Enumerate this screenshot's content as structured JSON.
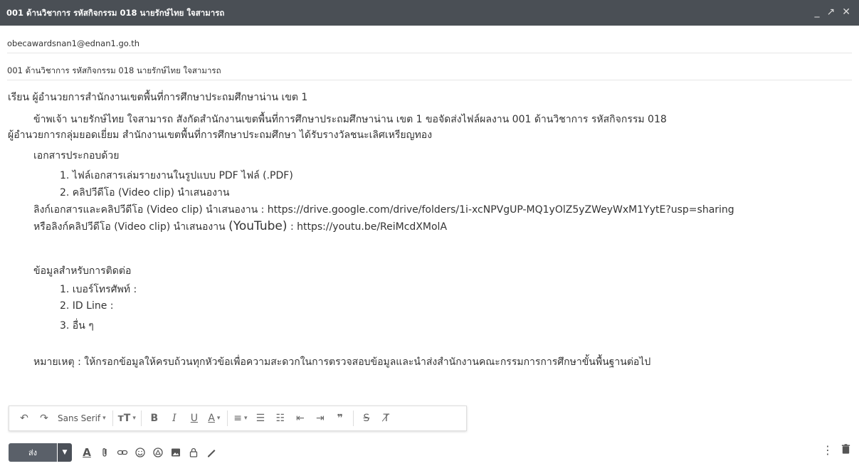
{
  "window": {
    "title": "001 ด้านวิชาการ รหัสกิจกรรม 018 นายรักษ์ไทย ใจสามารถ",
    "minimize_glyph": "_",
    "popout_glyph": "↗",
    "close_glyph": "✕"
  },
  "to": {
    "recipient": "obecawardsnan1@ednan1.go.th"
  },
  "subject": {
    "value": "001 ด้านวิชาการ รหัสกิจกรรม 018 นายรักษ์ไทย  ใจสามารถ"
  },
  "body": {
    "greeting": "เรียน ผู้อำนวยการสำนักงานเขตพื้นที่การศึกษาประถมศึกษาน่าน เขต 1",
    "para1": "ข้าพเจ้า นายรักษ์ไทย  ใจสามารถ สังกัดสำนักงานเขตพื้นที่การศึกษาประถมศึกษาน่าน เขต 1 ขอจัดส่งไฟล์ผลงาน 001 ด้านวิชาการ รหัสกิจกรรม 018",
    "para1_cont": "ผู้อำนวยการกลุ่มยอดเยี่ยม สำนักงานเขตพื้นที่การศึกษาประถมศึกษา ได้รับรางวัลชนะเลิศเหรียญทอง",
    "docs_heading": "เอกสารประกอบด้วย",
    "doc_1": "1. ไฟล์เอกสารเล่มรายงานในรูปแบบ PDF ไฟล์ (.PDF)",
    "doc_2": "2. คลิปวีดีโอ (Video clip) นำเสนองาน",
    "link_drive": "ลิงก์เอกสารและคลิปวีดีโอ (Video clip) นำเสนองาน : https://drive.google.com/drive/folders/1i-xcNPVgUP-MQ1yOlZ5yZWeyWxM1YytE?usp=sharing",
    "link_youtube_prefix": "หรือลิงก์คลิปวีดีโอ (Video clip) นำเสนองาน ",
    "link_youtube_brand": "(YouTube)",
    "link_youtube_suffix": " : https://youtu.be/ReiMcdXMolA",
    "contact_heading": "ข้อมูลสำหรับการติดต่อ",
    "contact_1": "1. เบอร์โทรศัพท์ :",
    "contact_2": "2. ID Line :",
    "contact_3": "3. อื่น ๆ",
    "note": "หมายเหตุ : ให้กรอกข้อมูลให้ครบถ้วนทุกหัวข้อเพื่อความสะดวกในการตรวจสอบข้อมูลและนำส่งสำนักงานคณะกรรมการการศึกษาขั้นพื้นฐานต่อไป"
  },
  "toolbar": {
    "font_family": "Sans Serif"
  },
  "bottom": {
    "send_label": "ส่ง"
  },
  "colors": {
    "titlebar": "#4a4f55",
    "send": "#5a6069"
  }
}
